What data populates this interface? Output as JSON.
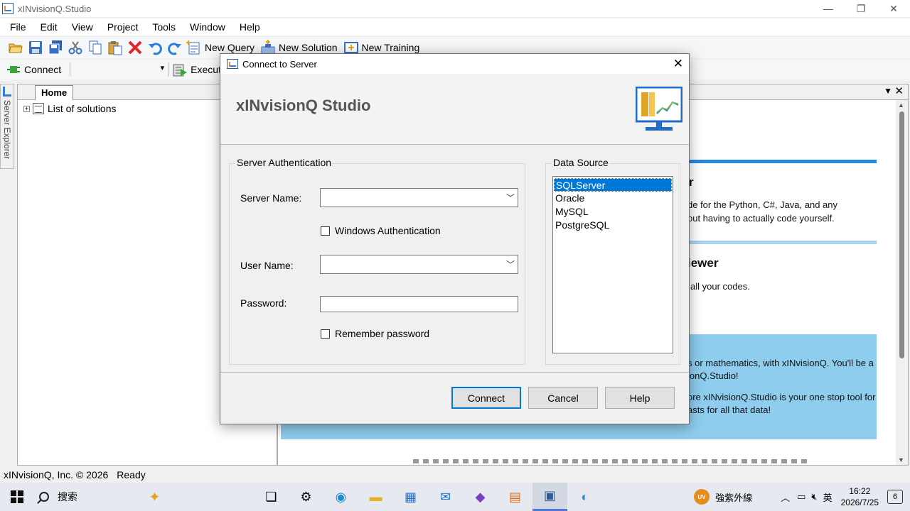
{
  "window": {
    "title": "xINvisionQ.Studio",
    "minimize": "—",
    "maximize": "❐",
    "close": "✕"
  },
  "menu": [
    "File",
    "Edit",
    "View",
    "Project",
    "Tools",
    "Window",
    "Help"
  ],
  "toolbar1": {
    "icons": [
      "open-folder-icon",
      "save-icon",
      "save-all-icon",
      "cut-icon",
      "copy-icon",
      "paste-icon",
      "delete-icon",
      "undo-icon",
      "redo-icon"
    ],
    "new_query": "New Query",
    "new_solution": "New Solution",
    "new_training": "New Training"
  },
  "toolbar2": {
    "connect": "Connect",
    "execute": "Execute"
  },
  "side_tab": {
    "label": "Server Explorer"
  },
  "left_panel": {
    "tab": "Home",
    "tree_root": "List of solutions",
    "expander": "+"
  },
  "right_panel": {
    "heading1_tail": "r",
    "text1a": "de for the Python, C#, Java, and any",
    "text1b": "out having to actually code yourself.",
    "heading2_tail": "iewer",
    "text2": "all your codes.",
    "info1a": "s or mathematics, with xINvisionQ. You'll be a",
    "info1b": "ionQ.Studio!",
    "info2a": "ore xINvisionQ.Studio is your one stop tool for",
    "info2b": "asts for all that data!"
  },
  "status": {
    "copyright": "xINvisionQ, Inc. © 2026",
    "state": "Ready"
  },
  "dialog": {
    "title": "Connect to Server",
    "close": "✕",
    "brand": "xINvisionQ Studio",
    "auth_group": "Server Authentication",
    "server_name_label": "Server Name:",
    "server_name_value": "",
    "windows_auth": "Windows Authentication",
    "user_name_label": "User Name:",
    "user_name_value": "",
    "password_label": "Password:",
    "password_value": "",
    "remember": "Remember password",
    "datasource_group": "Data Source",
    "datasources": [
      "SQLServer",
      "Oracle",
      "MySQL",
      "PostgreSQL"
    ],
    "selected_datasource": "SQLServer",
    "buttons": {
      "connect": "Connect",
      "cancel": "Cancel",
      "help": "Help"
    }
  },
  "taskbar": {
    "search_placeholder": "搜索",
    "weather": "強紫外線",
    "uv_badge": "UV",
    "ime": "英",
    "time": "16:22",
    "date": "2026/7/25",
    "notifications": "6"
  },
  "colors": {
    "accent": "#0078d7",
    "info_box": "#8ecdee",
    "bar_blue": "#2787d6",
    "bar_light": "#a6d2f2"
  }
}
